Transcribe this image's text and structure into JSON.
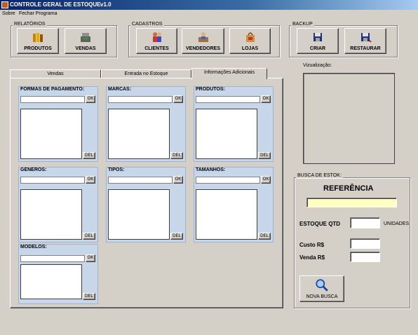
{
  "window": {
    "title": "CONTROLE GERAL DE ESTOQUE",
    "version": "v1.0"
  },
  "menu": [
    "Sobre",
    "Fechar Programa"
  ],
  "groups": {
    "relatorios": {
      "label": "RELATÓRIOS",
      "buttons": [
        "PRODUTOS",
        "VENDAS"
      ]
    },
    "cadastros": {
      "label": "CADASTROS",
      "buttons": [
        "CLIENTES",
        "VENDEDORES",
        "LOJAS"
      ]
    },
    "backup": {
      "label": "BACKUP",
      "buttons": [
        "CRIAR",
        "RESTAURAR"
      ]
    }
  },
  "tabs": [
    "Vendas",
    "Entrada no Estoque",
    "Informações Adicionais"
  ],
  "active_tab": 2,
  "categories": [
    "FORMAS DE PAGAMENTO:",
    "MARCAS:",
    "PRODUTOS:",
    "GENEROS:",
    "TIPOS:",
    "TAMANHOS:",
    "MODELOS:"
  ],
  "ok_label": "OK",
  "del_label": "DEL",
  "preview": {
    "label": "Vizualização:"
  },
  "search": {
    "group_label": "BUSCA DE ESTOK:",
    "heading": "REFERÊNCIA",
    "stock_label": "ESTOQUE QTD",
    "units_label": "UNIDADES",
    "cost_label": "Custo  R$",
    "sale_label": "Venda R$",
    "new_search_label": "NOVA BUSCA"
  },
  "colors": {
    "panel": "#c8d6ea",
    "reference_input": "#ffffc0",
    "title_start": "#0a246a"
  }
}
